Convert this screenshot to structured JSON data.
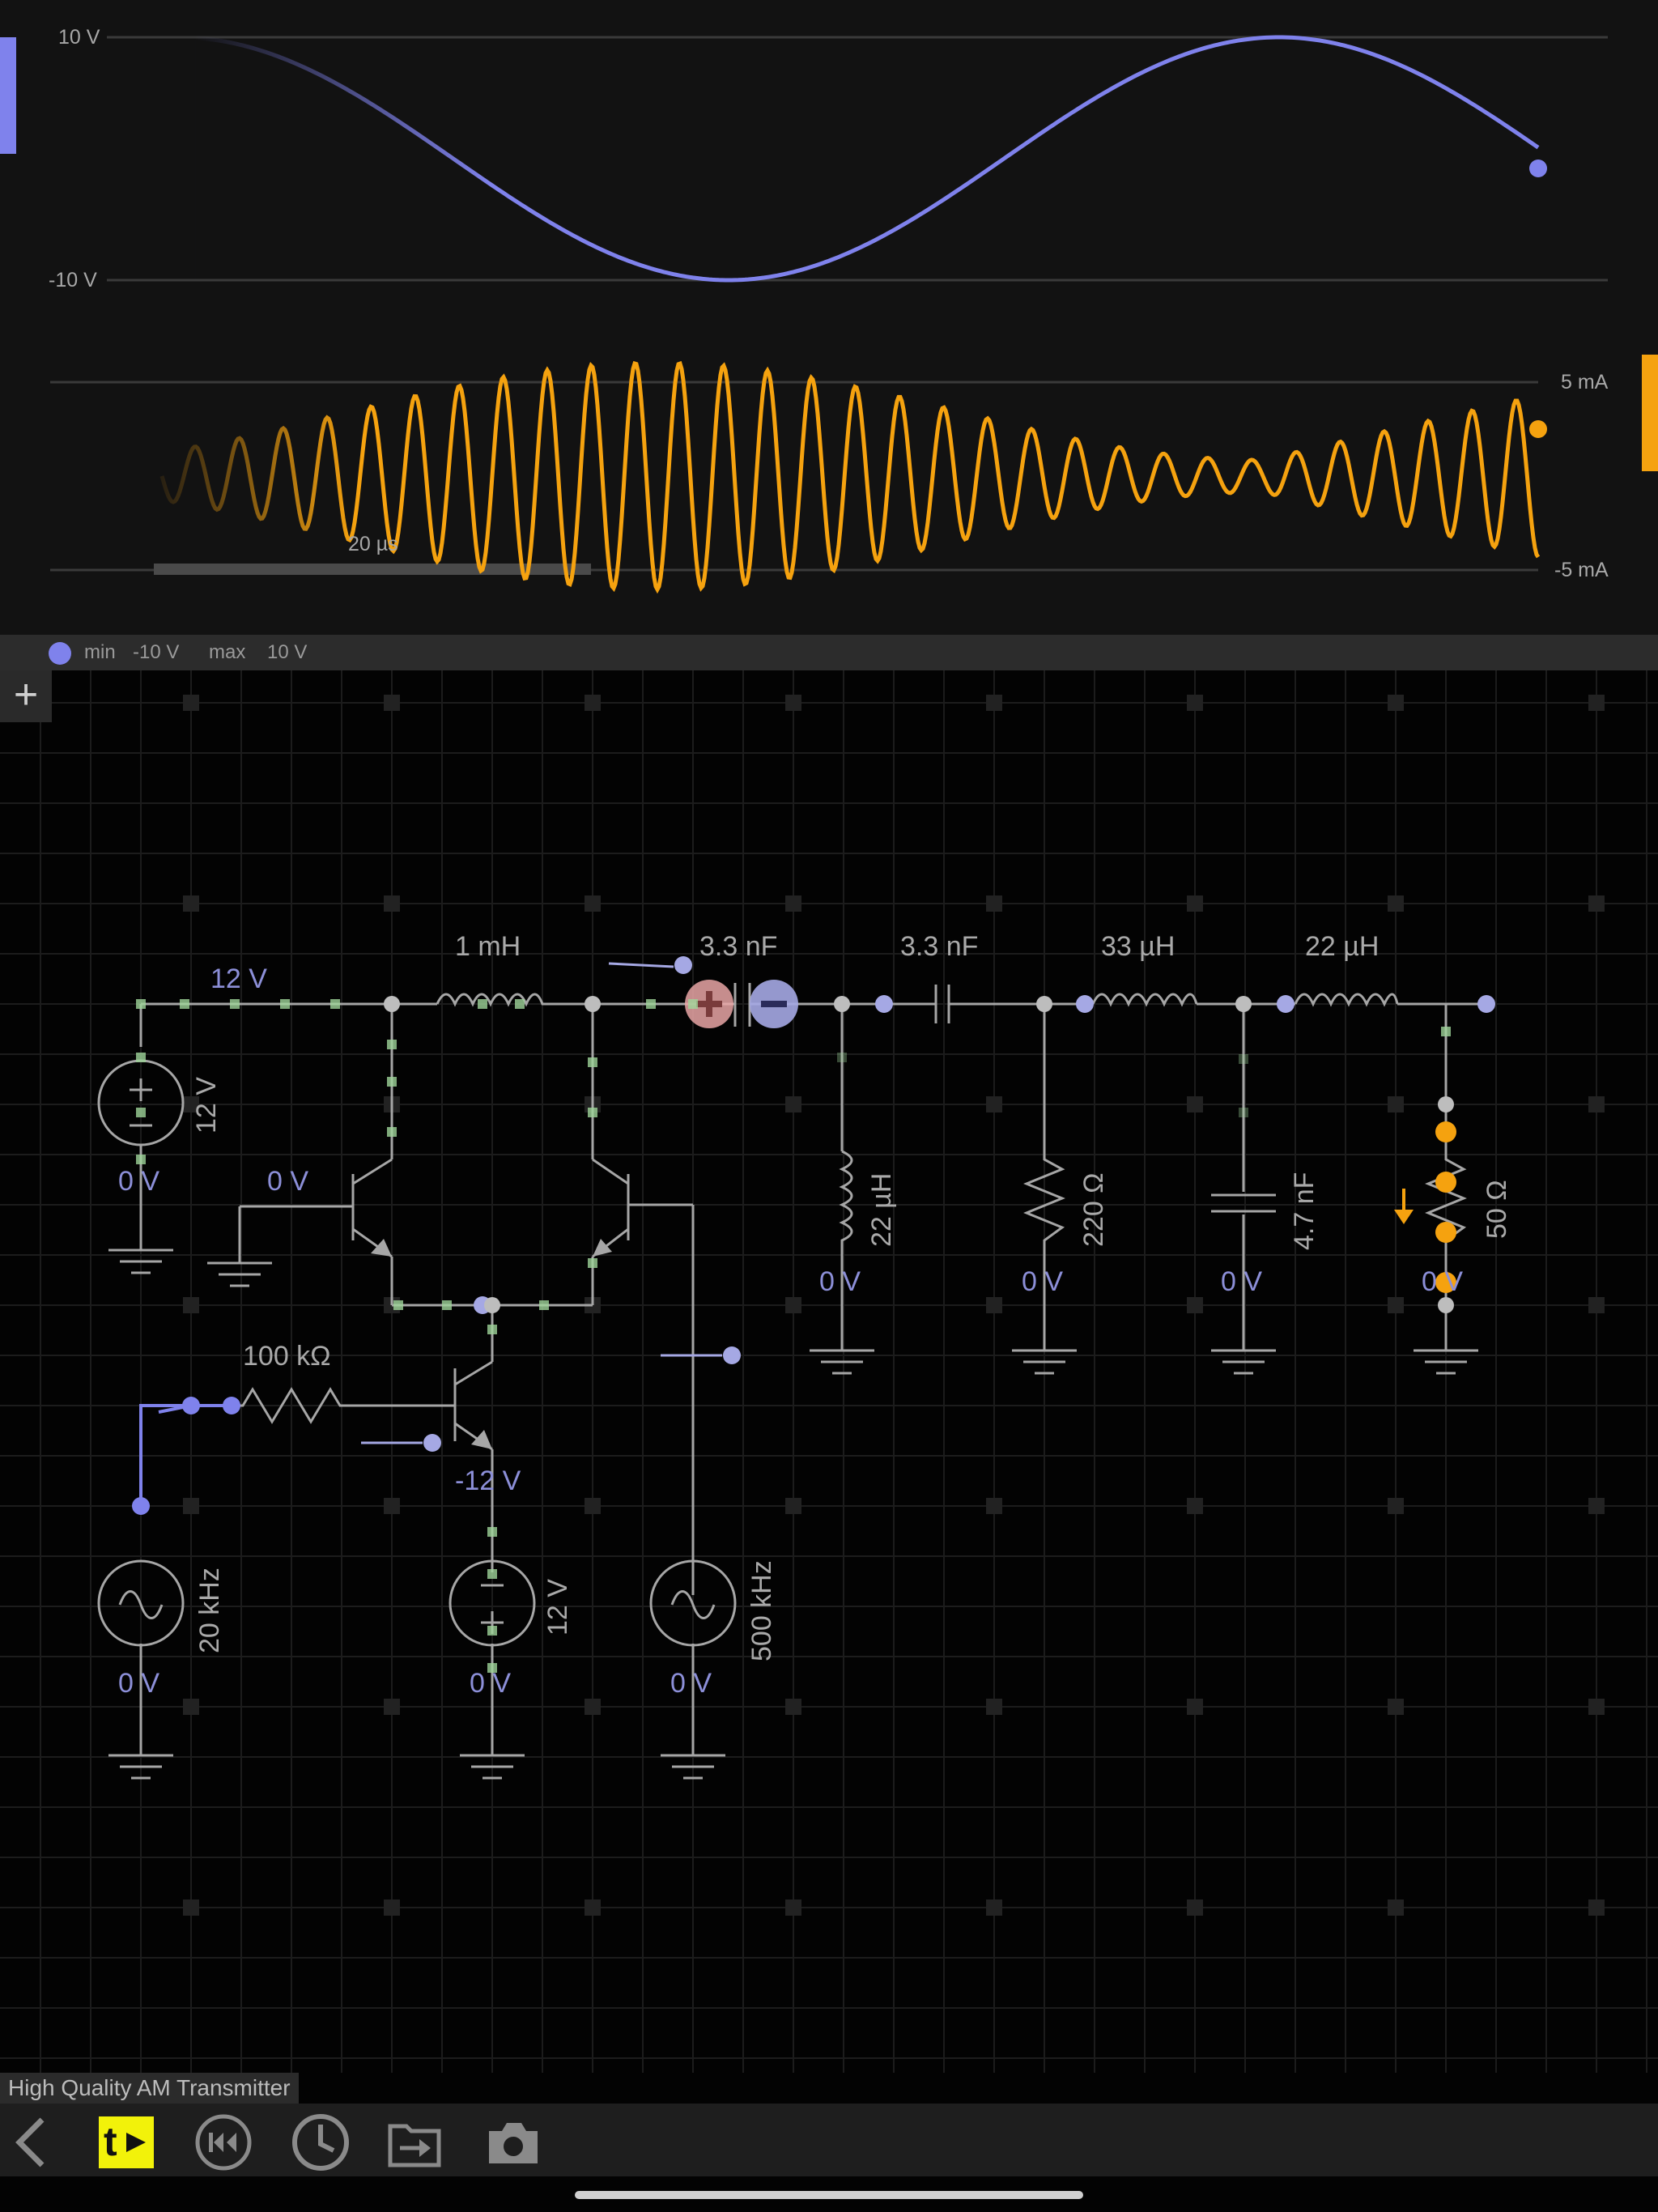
{
  "oscilloscope": {
    "voltage_trace": {
      "max_label": "10 V",
      "min_label": "-10 V",
      "color": "#7f82ec"
    },
    "current_trace": {
      "max_label": "5 mA",
      "min_label": "-5 mA",
      "color": "#f5a20f"
    },
    "timebase_label": "20 µs"
  },
  "probe_bar": {
    "min_label": "min",
    "min_value": "-10 V",
    "max_label": "max",
    "max_value": "10 V"
  },
  "add_button": {
    "symbol": "+"
  },
  "circuit": {
    "labels": {
      "supply_wire": "12 V",
      "inductor_1": "1 mH",
      "cap_electrolytic": "3.3 nF",
      "cap_2": "3.3 nF",
      "inductor_2": "33 µH",
      "inductor_3": "22 µH",
      "inductor_shunt": "22 µH",
      "resistor_220": "220 Ω",
      "cap_shunt": "4.7 nF",
      "resistor_load": "50 Ω",
      "dc_source_left": "12 V",
      "dc_source_bottom": "12 V",
      "base_ground_v": "0 V",
      "resistor_100k": "100 kΩ",
      "neg_supply": "-12 V",
      "ac_source_left": "20 kHz",
      "ac_source_right": "500 kHz",
      "ground_v": "0 V"
    }
  },
  "document_title": "High Quality AM Transmitter",
  "toolbar": {
    "icons": [
      "back-icon",
      "simulation-mode-icon",
      "rewind-icon",
      "clock-icon",
      "export-icon",
      "camera-icon"
    ],
    "active_color": "#f2f20a"
  }
}
